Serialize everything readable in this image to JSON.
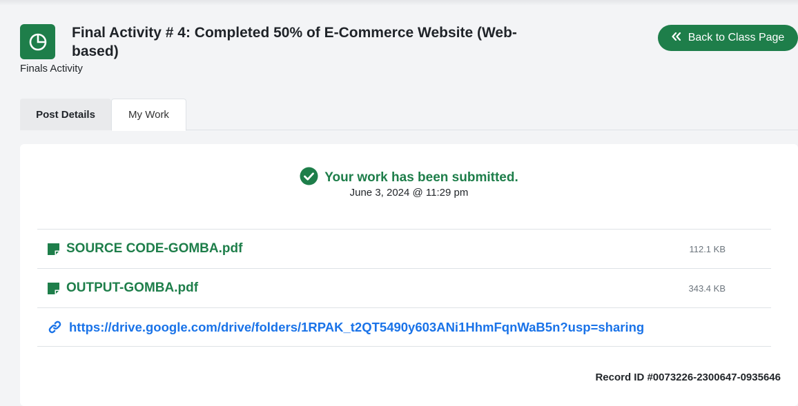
{
  "header": {
    "title": "Final Activity # 4: Completed 50% of E-Commerce Website (Web-based)",
    "subtitle": "Finals Activity",
    "icon": "pie-chart-icon",
    "back_button_label": "Back to Class Page",
    "back_button_icon": "double-chevron-left-icon"
  },
  "tabs": [
    {
      "label": "Post Details",
      "active": false
    },
    {
      "label": "My Work",
      "active": true
    }
  ],
  "submission": {
    "status_text": "Your work has been submitted.",
    "status_icon": "check-circle-icon",
    "timestamp": "June 3, 2024 @ 11:29 pm"
  },
  "attachments": [
    {
      "name": "SOURCE CODE-GOMBA.pdf",
      "size": "112.1 KB",
      "icon": "file-icon"
    },
    {
      "name": "OUTPUT-GOMBA.pdf",
      "size": "343.4 KB",
      "icon": "file-icon"
    }
  ],
  "link": {
    "url": "https://drive.google.com/drive/folders/1RPAK_t2QT5490y603ANi1HhmFqnWaB5n?usp=sharing",
    "icon": "link-icon"
  },
  "record_id": "Record ID #0073226-2300647-0935646",
  "colors": {
    "accent": "#1e7e4a",
    "link": "#1a73e8",
    "background": "#f3f4f6"
  }
}
